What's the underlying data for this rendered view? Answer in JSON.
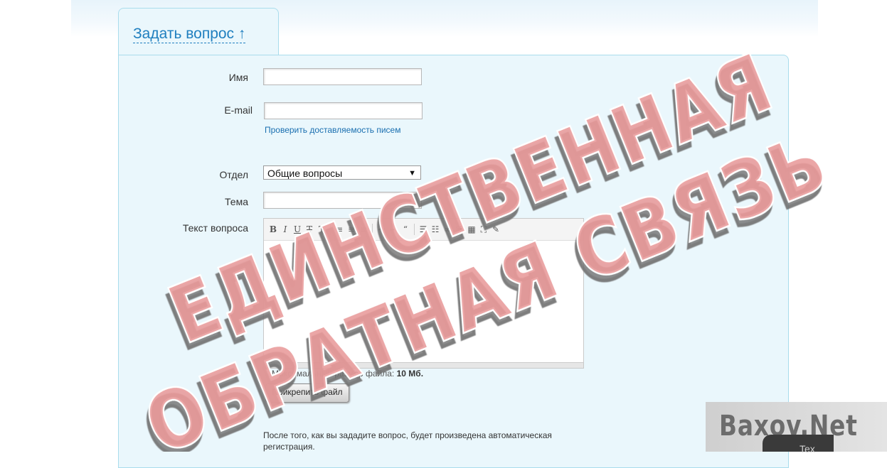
{
  "tab": {
    "title": "Задать вопрос ↑"
  },
  "form": {
    "name_label": "Имя",
    "email_label": "E-mail",
    "email_check_link": "Проверить доставляемость писем",
    "department_label": "Отдел",
    "department_value": "Общие вопросы",
    "subject_label": "Тема",
    "text_label": "Текст вопроса",
    "file_note": "Максимальный размер файла:",
    "file_size": "10 Мб.",
    "attach_button": "Прикрепить файл",
    "after_note": "После того, как вы зададите вопрос, будет произведена автоматическая регистрация."
  },
  "toolbar": {
    "icons": [
      "bold-icon",
      "italic-icon",
      "underline-icon",
      "strikethrough-icon",
      "clear-format-icon",
      "align-left-icon",
      "align-center-icon",
      "align-right-icon",
      "indent-icon",
      "outdent-icon",
      "quote-icon",
      "bullet-list-icon",
      "numbered-list-icon",
      "link-icon",
      "image-icon",
      "table-icon",
      "fullscreen-icon",
      "eraser-icon"
    ]
  },
  "stamp": {
    "line1": "ЕДИНСТВЕННАЯ",
    "line2": "ОБРАТНАЯ СВЯЗЬ",
    "color": "#e89a9a"
  },
  "watermark": {
    "text": "Baxov.Net",
    "sub": "Tex"
  }
}
